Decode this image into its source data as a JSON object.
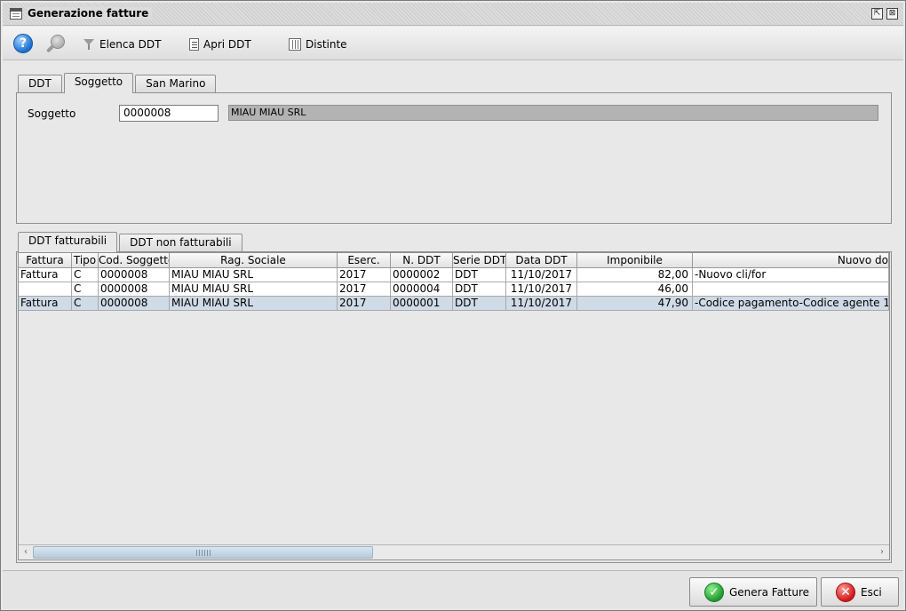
{
  "window": {
    "title": "Generazione fatture",
    "restore_glyph": "⇱",
    "maximize_glyph": "⊠"
  },
  "toolbar": {
    "help_glyph": "?",
    "items": [
      {
        "label": "Elenca DDT",
        "icon": "funnel-icon"
      },
      {
        "label": "Apri DDT",
        "icon": "document-icon"
      },
      {
        "label": "Distinte",
        "icon": "list-icon"
      }
    ]
  },
  "top_tabs": [
    {
      "label": "DDT",
      "active": false
    },
    {
      "label": "Soggetto",
      "active": true
    },
    {
      "label": "San Marino",
      "active": false
    }
  ],
  "soggetto": {
    "label": "Soggetto",
    "code": "0000008",
    "name": "MIAU MIAU SRL"
  },
  "bottom_tabs": [
    {
      "label": "DDT fatturabili",
      "active": true
    },
    {
      "label": "DDT non fatturabili",
      "active": false
    }
  ],
  "table": {
    "columns": [
      "Fattura",
      "Tipo",
      "Cod. Soggetto",
      "Rag. Sociale",
      "Eserc.",
      "N. DDT",
      "Serie DDT",
      "Data DDT",
      "Imponibile",
      "Nuovo do"
    ],
    "rows": [
      [
        "Fattura",
        "C",
        "0000008",
        "MIAU MIAU SRL",
        "2017",
        "0000002",
        "DDT",
        "11/10/2017",
        "82,00",
        "-Nuovo cli/for"
      ],
      [
        "",
        "C",
        "0000008",
        "MIAU MIAU SRL",
        "2017",
        "0000004",
        "DDT",
        "11/10/2017",
        "46,00",
        ""
      ],
      [
        "Fattura",
        "C",
        "0000008",
        "MIAU MIAU SRL",
        "2017",
        "0000001",
        "DDT",
        "11/10/2017",
        "47,90",
        "-Codice pagamento-Codice agente 1"
      ]
    ],
    "selected_row": 2
  },
  "scroll": {
    "left_glyph": "‹",
    "right_glyph": "›"
  },
  "buttons": {
    "genera": {
      "label": "Genera Fatture",
      "glyph": "✓"
    },
    "esci": {
      "label": "Esci",
      "glyph": "✕"
    }
  }
}
